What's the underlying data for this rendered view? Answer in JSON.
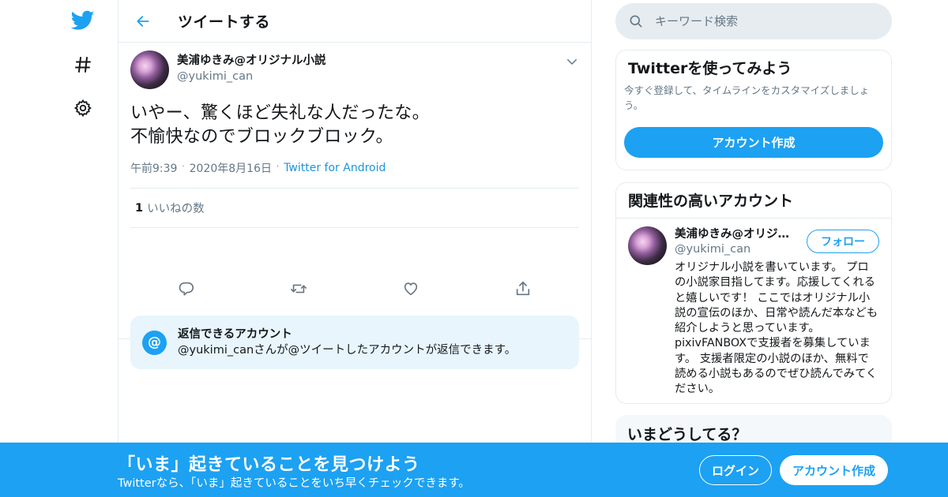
{
  "colors": {
    "accent": "#1da1f2",
    "link": "#1b95e0",
    "muted": "#657786",
    "divider": "#e6ecf0"
  },
  "nav": {
    "items": [
      {
        "icon": "twitter-bird-icon"
      },
      {
        "icon": "hashtag-icon"
      },
      {
        "icon": "gear-icon"
      }
    ]
  },
  "header": {
    "title": "ツイートする"
  },
  "tweet": {
    "author_name": "美浦ゆきみ@オリジナル小説",
    "author_handle": "@yukimi_can",
    "text_line1": "いやー、驚くほど失礼な人だったな。",
    "text_line2": "不愉快なのでブロックブロック。",
    "time": "午前9:39",
    "date": "2020年8月16日",
    "source": "Twitter for Android",
    "separator": "·",
    "likes_count": "1",
    "likes_label": "いいねの数"
  },
  "reply_restriction": {
    "icon_text": "@",
    "title": "返信できるアカウント",
    "description": "@yukimi_canさんが@ツイートしたアカウントが返信できます。"
  },
  "sidebar": {
    "search_placeholder": "キーワード検索",
    "signup_card": {
      "title": "Twitterを使ってみよう",
      "description": "今すぐ登録して、タイムラインをカスタマイズしましょう。",
      "button": "アカウント作成"
    },
    "related": {
      "title": "関連性の高いアカウント",
      "name": "美浦ゆきみ@オリジ…",
      "handle": "@yukimi_can",
      "follow": "フォロー",
      "bio": "オリジナル小説を書いています。 プロの小説家目指してます。応援してくれると嬉しいです！ ここではオリジナル小説の宣伝のほか、日常や読んだ本なども紹介しようと思っています。 pixivFANBOXで支援者を募集しています。 支援者限定の小説のほか、無料で読める小説もあるのでぜひ読んでみてください。"
    },
    "whats_happening": {
      "title": "いまどうしてる？"
    }
  },
  "banner": {
    "title": "「いま」起きていることを見つけよう",
    "subtitle": "Twitterなら、「いま」起きていることをいち早くチェックできます。",
    "login": "ログイン",
    "signup": "アカウント作成"
  }
}
